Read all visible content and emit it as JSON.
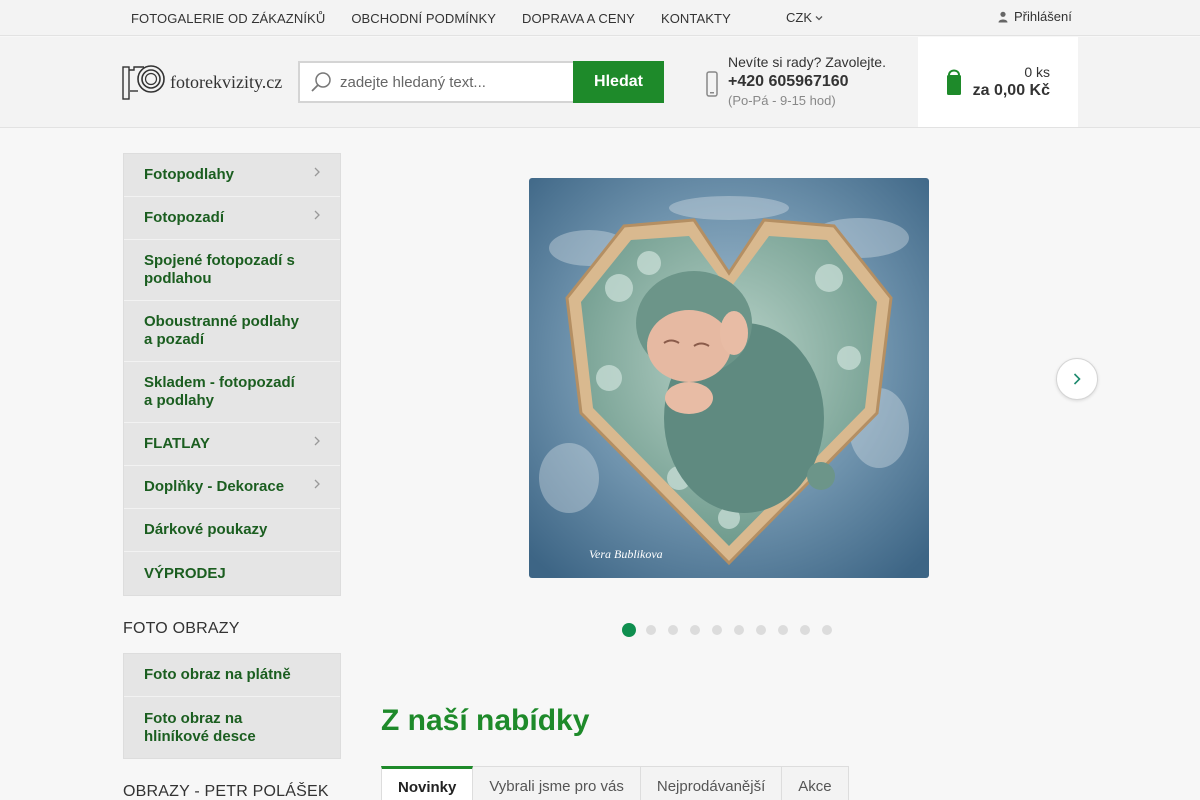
{
  "topnav": {
    "links": [
      "FOTOGALERIE OD ZÁKAZNÍKŮ",
      "OBCHODNÍ PODMÍNKY",
      "DOPRAVA A CENY",
      "KONTAKTY"
    ],
    "currency": "CZK",
    "login": "Přihlášení"
  },
  "header": {
    "logo_text": "fotorekvizity.cz",
    "search": {
      "placeholder": "zadejte hledaný text...",
      "button": "Hledat"
    },
    "contact": {
      "line1": "Nevíte si rady? Zavolejte.",
      "phone": "+420 605967160",
      "hours": "(Po-Pá - 9-15 hod)"
    },
    "cart": {
      "count": "0 ks",
      "total": "za 0,00 Kč"
    }
  },
  "sidebar": {
    "categories": [
      {
        "label": "Fotopodlahy",
        "has_sub": true
      },
      {
        "label": "Fotopozadí",
        "has_sub": true
      },
      {
        "label": "Spojené fotopozadí s podlahou",
        "has_sub": false
      },
      {
        "label": "Oboustranné podlahy a pozadí",
        "has_sub": false
      },
      {
        "label": "Skladem - fotopozadí a podlahy",
        "has_sub": false
      },
      {
        "label": "FLATLAY",
        "has_sub": true
      },
      {
        "label": "Doplňky - Dekorace",
        "has_sub": true
      },
      {
        "label": "Dárkové poukazy",
        "has_sub": false
      },
      {
        "label": "VÝPRODEJ",
        "has_sub": false
      }
    ],
    "foto_obrazy": {
      "heading": "FOTO OBRAZY",
      "items": [
        "Foto obraz na plátně",
        "Foto obraz na hliníkové desce"
      ]
    },
    "obrazy_heading": "OBRAZY - PETR POLÁŠEK"
  },
  "slider": {
    "slide_count": 10,
    "active_index": 0,
    "watermark": "Vera Bublikova"
  },
  "offer": {
    "title": "Z naší nabídky",
    "tabs": [
      "Novinky",
      "Vybrali jsme pro vás",
      "Nejprodávanější",
      "Akce"
    ],
    "active_tab": 0
  },
  "colors": {
    "brand_green": "#1e8a2a",
    "menu_text": "#1b5e20",
    "dot_active": "#0f8f4f"
  },
  "icons": [
    "user-icon",
    "search-icon",
    "phone-icon",
    "cart-icon",
    "chevron-right-icon",
    "chevron-down-icon"
  ]
}
